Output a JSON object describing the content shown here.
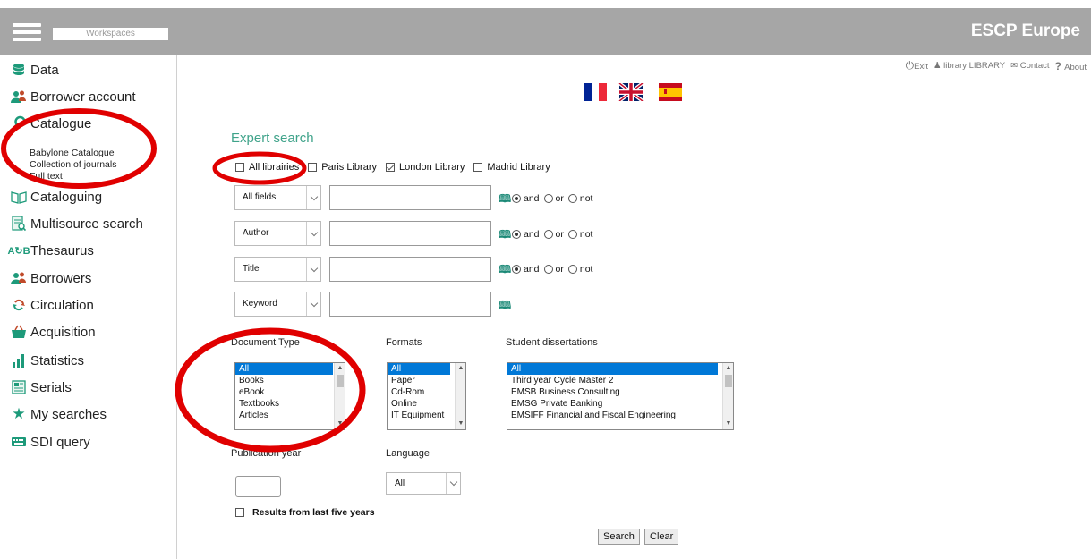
{
  "topbar": {
    "workspaces_label": "Workspaces",
    "brand": "ESCP Europe",
    "background_color": "#a6a6a6"
  },
  "toplinks": {
    "exit": "Exit",
    "library": "library LIBRARY",
    "contact": "Contact",
    "about": "About"
  },
  "sidebar": {
    "items": [
      {
        "label": "Data",
        "icon": "database-icon"
      },
      {
        "label": "Borrower account",
        "icon": "users-icon"
      },
      {
        "label": "Catalogue",
        "icon": "search-icon"
      },
      {
        "label": "Cataloguing",
        "icon": "open-book-icon"
      },
      {
        "label": "Multisource search",
        "icon": "document-search-icon"
      },
      {
        "label": "Thesaurus",
        "icon": "translate-icon"
      },
      {
        "label": "Borrowers",
        "icon": "users-icon"
      },
      {
        "label": "Circulation",
        "icon": "refresh-icon"
      },
      {
        "label": "Acquisition",
        "icon": "basket-icon"
      },
      {
        "label": "Statistics",
        "icon": "bar-chart-icon"
      },
      {
        "label": "Serials",
        "icon": "newspaper-icon"
      },
      {
        "label": "My searches",
        "icon": "star-icon"
      },
      {
        "label": "SDI query",
        "icon": "keyboard-icon"
      }
    ],
    "catalogue_sub": [
      "Babylone Catalogue",
      "Collection of journals",
      "Full text"
    ]
  },
  "search": {
    "heading": "Expert search",
    "libraries": [
      {
        "label": "All librairies",
        "checked": false
      },
      {
        "label": "Paris Library",
        "checked": false
      },
      {
        "label": "London Library",
        "checked": true
      },
      {
        "label": "Madrid Library",
        "checked": false
      }
    ],
    "rows": [
      {
        "field": "All fields",
        "value": "",
        "operators": [
          "and",
          "or",
          "not"
        ],
        "selected_operator": "and"
      },
      {
        "field": "Author",
        "value": "",
        "operators": [
          "and",
          "or",
          "not"
        ],
        "selected_operator": "and"
      },
      {
        "field": "Title",
        "value": "",
        "operators": [
          "and",
          "or",
          "not"
        ],
        "selected_operator": "and"
      },
      {
        "field": "Keyword",
        "value": ""
      }
    ],
    "document_type": {
      "label": "Document Type",
      "options": [
        "All",
        "Books",
        "eBook",
        "Textbooks",
        "Articles"
      ]
    },
    "formats": {
      "label": "Formats",
      "options": [
        "All",
        "Paper",
        "Cd-Rom",
        "Online",
        "IT Equipment"
      ]
    },
    "dissertations": {
      "label": "Student dissertations",
      "options": [
        "All",
        "Third year Cycle Master 2",
        "EMSB Business Consulting",
        "EMSG Private Banking",
        "EMSIFF Financial and Fiscal Engineering"
      ]
    },
    "publication_year": {
      "label": "Publication year",
      "value": ""
    },
    "language": {
      "label": "Language",
      "value": "All"
    },
    "last_five_years": {
      "label": "Results from last five years",
      "checked": false
    },
    "search_button": "Search",
    "clear_button": "Clear"
  },
  "colors": {
    "heading": "#3fa38a",
    "selection": "#0078d7",
    "annotation": "#e00000"
  }
}
